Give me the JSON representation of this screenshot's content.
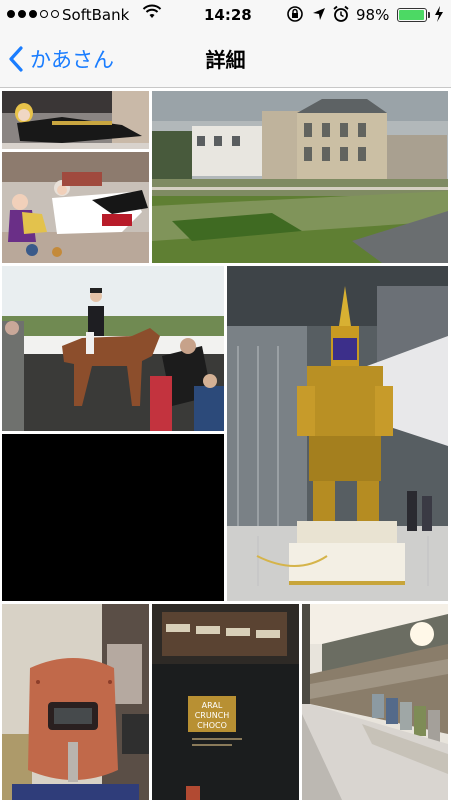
{
  "status_bar": {
    "signal_dots": [
      true,
      true,
      true,
      false,
      false
    ],
    "carrier": "SoftBank",
    "time": "14:28",
    "battery_percent": "98%",
    "battery_level": 0.98,
    "battery_color": "#4cd964",
    "icons": [
      "wifi-icon",
      "rotation-lock-icon",
      "location-arrow-icon",
      "alarm-icon",
      "charging-bolt-icon"
    ]
  },
  "nav": {
    "back_label": "かあさん",
    "title": "詳細",
    "accent_color": "#1a7dff"
  },
  "photos": [
    {
      "name": "photo-cosplay-black-dress",
      "subject": "costume"
    },
    {
      "name": "photo-cosplay-group",
      "subject": "costume"
    },
    {
      "name": "photo-chateau-street",
      "subject": "building"
    },
    {
      "name": "photo-horse-rider",
      "subject": "horse"
    },
    {
      "name": "photo-thai-guardian-statue",
      "subject": "statue"
    },
    {
      "name": "photo-black",
      "subject": "black"
    },
    {
      "name": "photo-welding-mask",
      "subject": "mask"
    },
    {
      "name": "photo-chocolate-box",
      "subject": "chocolate"
    },
    {
      "name": "photo-snowy-alley",
      "subject": "snow"
    }
  ],
  "chocolate_label": {
    "line1": "ARAL",
    "line2": "CRUNCH",
    "line3": "CHOCO"
  }
}
